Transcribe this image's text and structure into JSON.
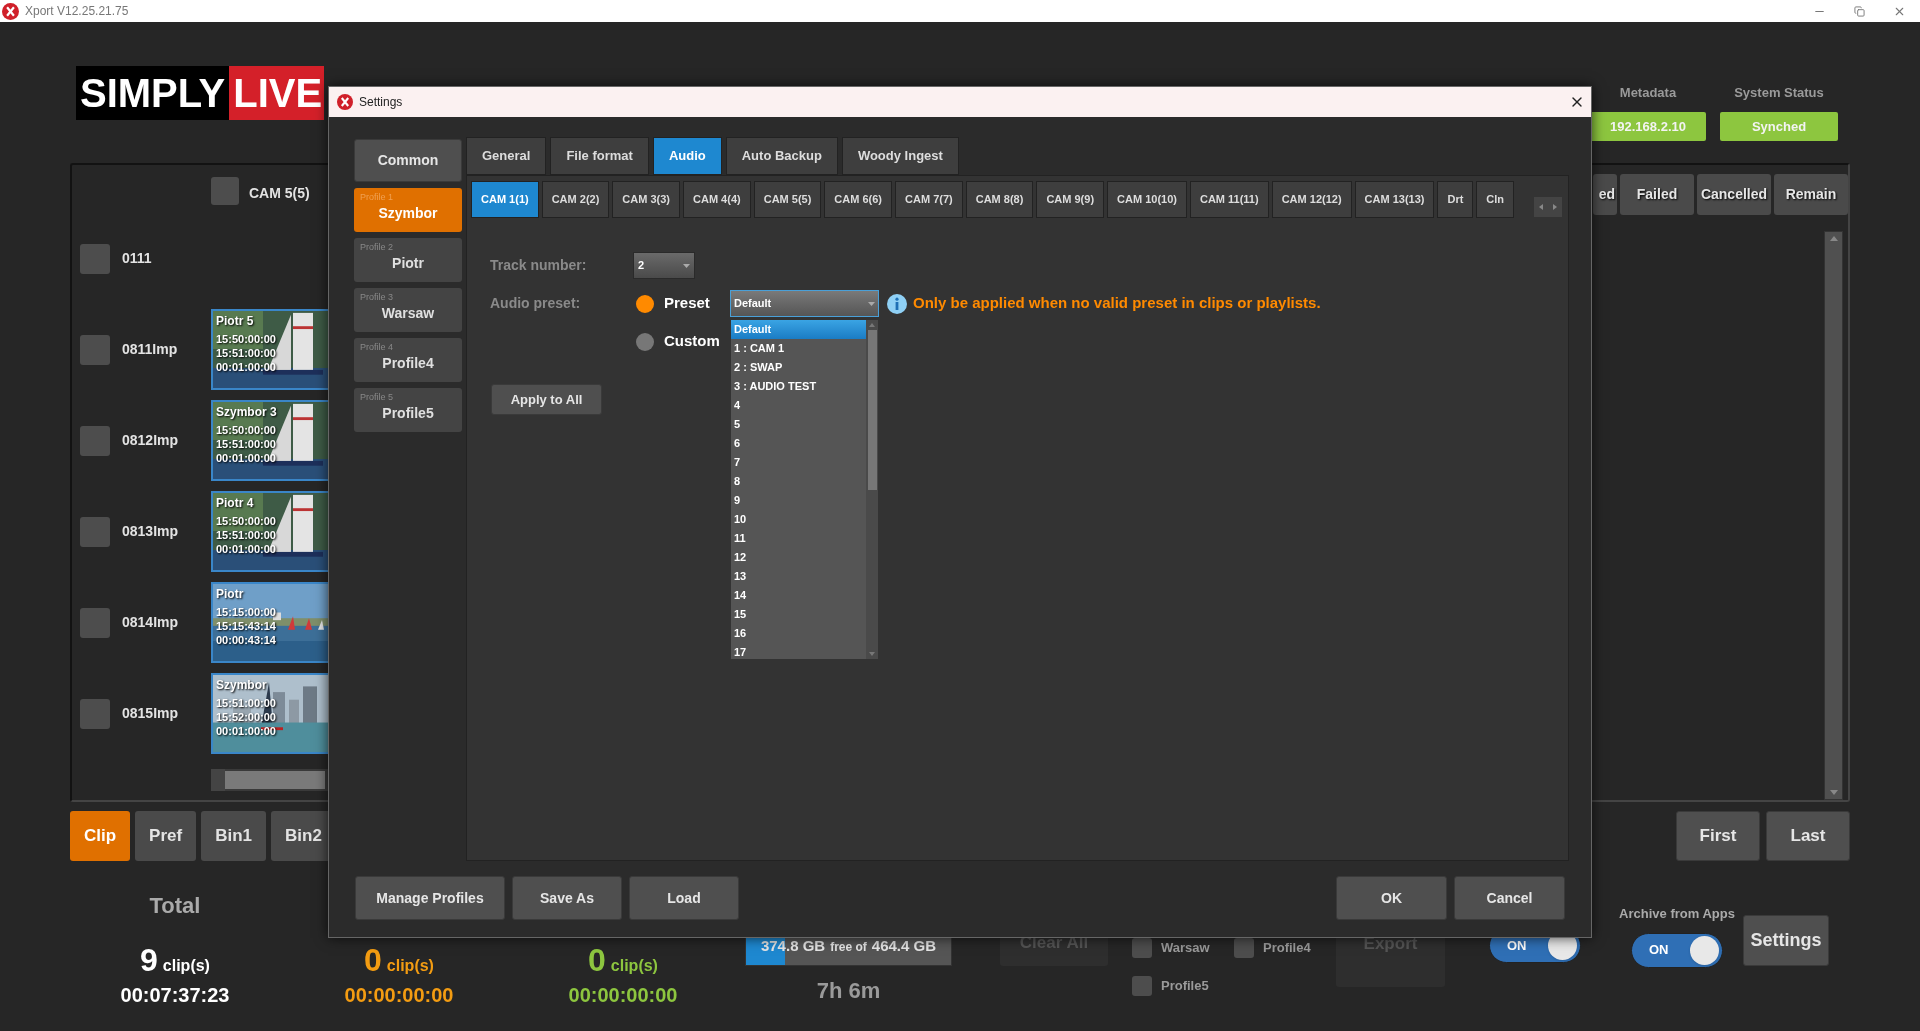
{
  "app_window": {
    "title": "Xport V12.25.21.75"
  },
  "logo": {
    "word_1": "SIMPLY",
    "word_2": "LIVE"
  },
  "header": {
    "metadata": {
      "label": "Metadata",
      "value": "192.168.2.10"
    },
    "system_status": {
      "label": "System Status",
      "value": "Synched"
    }
  },
  "clip_list": {
    "camera": {
      "label": "CAM 5(5)",
      "checked": false
    },
    "rows": [
      {
        "label": "0111",
        "checked": false
      },
      {
        "label": "0811Imp",
        "checked": false,
        "clip": {
          "name": "Piotr 5",
          "in": "15:50:00:00",
          "out": "15:51:00:00",
          "duration": "00:01:00:00"
        }
      },
      {
        "label": "0812Imp",
        "checked": false,
        "clip": {
          "name": "Szymbor 3",
          "in": "15:50:00:00",
          "out": "15:51:00:00",
          "duration": "00:01:00:00"
        }
      },
      {
        "label": "0813Imp",
        "checked": false,
        "clip": {
          "name": "Piotr 4",
          "in": "15:50:00:00",
          "out": "15:51:00:00",
          "duration": "00:01:00:00"
        }
      },
      {
        "label": "0814Imp",
        "checked": false,
        "clip": {
          "name": "Piotr",
          "in": "15:15:00:00",
          "out": "15:15:43:14",
          "duration": "00:00:43:14"
        }
      },
      {
        "label": "0815Imp",
        "checked": false,
        "clip": {
          "name": "Szymbor",
          "in": "15:51:00:00",
          "out": "15:52:00:00",
          "duration": "00:01:00:00"
        }
      }
    ]
  },
  "status_columns": [
    "ed",
    "Failed",
    "Cancelled",
    "Remain"
  ],
  "view_tabs": [
    {
      "label": "Clip",
      "selected": true
    },
    {
      "label": "Pref",
      "selected": false
    },
    {
      "label": "Bin1",
      "selected": false
    },
    {
      "label": "Bin2",
      "selected": false
    }
  ],
  "nav_buttons": [
    "First",
    "Last"
  ],
  "stats": [
    {
      "label": "Total",
      "count": "9",
      "unit": "clip(s)",
      "time": "00:07:37:23",
      "color": "#ffffff"
    },
    {
      "count": "0",
      "unit": "clip(s)",
      "time": "00:00:00:00",
      "color": "#f39c12"
    },
    {
      "count": "0",
      "unit": "clip(s)",
      "time": "00:00:00:00",
      "color": "#8dc63f"
    }
  ],
  "storage": {
    "free": "374.8 GB",
    "separator": "free of",
    "total": "464.4 GB",
    "level": 0.19,
    "remaining": "7h 6m"
  },
  "clear_all": {
    "label": "Clear All",
    "disabled": true
  },
  "profile_checks": [
    {
      "label": "Warsaw",
      "checked": false
    },
    {
      "label": "Profile4",
      "checked": false
    },
    {
      "label": "Profile5",
      "checked": false
    }
  ],
  "export": {
    "label": "Export",
    "disabled": true
  },
  "toggle": {
    "label": "ON",
    "on": true
  },
  "archive": {
    "label": "Archive from Apps",
    "toggle": {
      "label": "ON",
      "on": true
    }
  },
  "settings_button": "Settings",
  "dialog": {
    "title": "Settings",
    "common": "Common",
    "profiles": [
      {
        "number": "Profile 1",
        "name": "Szymbor",
        "selected": true
      },
      {
        "number": "Profile 2",
        "name": "Piotr",
        "selected": false
      },
      {
        "number": "Profile 3",
        "name": "Warsaw",
        "selected": false
      },
      {
        "number": "Profile 4",
        "name": "Profile4",
        "selected": false
      },
      {
        "number": "Profile 5",
        "name": "Profile5",
        "selected": false
      }
    ],
    "tabs": [
      {
        "label": "General",
        "selected": false
      },
      {
        "label": "File format",
        "selected": false
      },
      {
        "label": "Audio",
        "selected": true
      },
      {
        "label": "Auto Backup",
        "selected": false
      },
      {
        "label": "Woody Ingest",
        "selected": false
      }
    ],
    "camera_tabs": [
      {
        "label": "CAM 1(1)",
        "selected": true
      },
      {
        "label": "CAM 2(2)",
        "selected": false
      },
      {
        "label": "CAM 3(3)",
        "selected": false
      },
      {
        "label": "CAM 4(4)",
        "selected": false
      },
      {
        "label": "CAM 5(5)",
        "selected": false
      },
      {
        "label": "CAM 6(6)",
        "selected": false
      },
      {
        "label": "CAM 7(7)",
        "selected": false
      },
      {
        "label": "CAM 8(8)",
        "selected": false
      },
      {
        "label": "CAM 9(9)",
        "selected": false
      },
      {
        "label": "CAM 10(10)",
        "selected": false
      },
      {
        "label": "CAM 11(11)",
        "selected": false
      },
      {
        "label": "CAM 12(12)",
        "selected": false
      },
      {
        "label": "CAM 13(13)",
        "selected": false
      },
      {
        "label": "Drt",
        "selected": false
      },
      {
        "label": "Cln",
        "selected": false
      }
    ],
    "track_number": {
      "label": "Track number:",
      "value": "2"
    },
    "audio_preset": {
      "label": "Audio preset:",
      "options": [
        {
          "label": "Preset",
          "selected": true
        },
        {
          "label": "Custom",
          "selected": false
        }
      ],
      "value": "Default",
      "info": "Only be applied when no valid preset in clips or playlists.",
      "list": [
        {
          "label": "Default",
          "selected": true
        },
        {
          "label": "1 : CAM 1",
          "selected": false
        },
        {
          "label": "2 : SWAP",
          "selected": false
        },
        {
          "label": "3 : AUDIO TEST",
          "selected": false
        },
        {
          "label": "4",
          "selected": false
        },
        {
          "label": "5",
          "selected": false
        },
        {
          "label": "6",
          "selected": false
        },
        {
          "label": "7",
          "selected": false
        },
        {
          "label": "8",
          "selected": false
        },
        {
          "label": "9",
          "selected": false
        },
        {
          "label": "10",
          "selected": false
        },
        {
          "label": "11",
          "selected": false
        },
        {
          "label": "12",
          "selected": false
        },
        {
          "label": "13",
          "selected": false
        },
        {
          "label": "14",
          "selected": false
        },
        {
          "label": "15",
          "selected": false
        },
        {
          "label": "16",
          "selected": false
        },
        {
          "label": "17",
          "selected": false
        }
      ]
    },
    "apply_all": "Apply to All",
    "footer_left": [
      "Manage Profiles",
      "Save As",
      "Load"
    ],
    "footer_right": [
      "OK",
      "Cancel"
    ]
  }
}
